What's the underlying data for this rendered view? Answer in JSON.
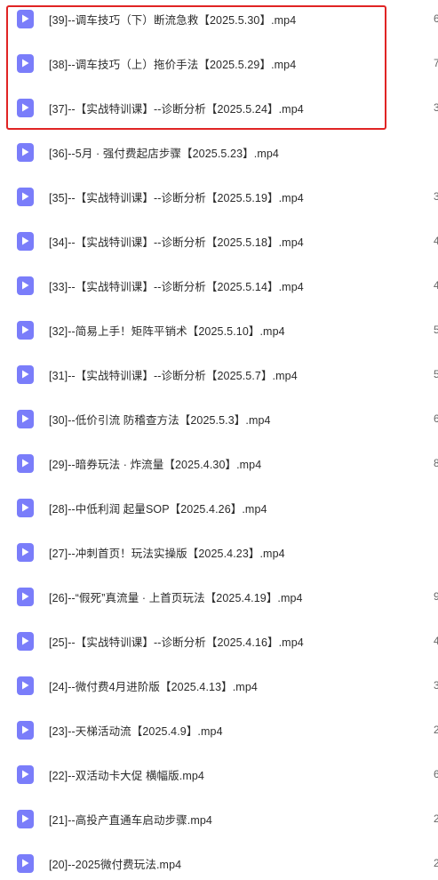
{
  "files": [
    {
      "name": "[39]--调车技巧（下）断流急救【2025.5.30】.mp4",
      "peek": "6"
    },
    {
      "name": "[38]--调车技巧（上）拖价手法【2025.5.29】.mp4",
      "peek": "7"
    },
    {
      "name": "[37]--【实战特训课】--诊断分析【2025.5.24】.mp4",
      "peek": "3"
    },
    {
      "name": "[36]--5月 · 强付费起店步骤【2025.5.23】.mp4",
      "peek": ""
    },
    {
      "name": "[35]--【实战特训课】--诊断分析【2025.5.19】.mp4",
      "peek": "3"
    },
    {
      "name": "[34]--【实战特训课】--诊断分析【2025.5.18】.mp4",
      "peek": "4"
    },
    {
      "name": "[33]--【实战特训课】--诊断分析【2025.5.14】.mp4",
      "peek": "4"
    },
    {
      "name": "[32]--简易上手！矩阵平销术【2025.5.10】.mp4",
      "peek": "5"
    },
    {
      "name": "[31]--【实战特训课】--诊断分析【2025.5.7】.mp4",
      "peek": "5"
    },
    {
      "name": "[30]--低价引流 防稽查方法【2025.5.3】.mp4",
      "peek": "6"
    },
    {
      "name": "[29]--暗券玩法 · 炸流量【2025.4.30】.mp4",
      "peek": "8"
    },
    {
      "name": "[28]--中低利润 起量SOP【2025.4.26】.mp4",
      "peek": ""
    },
    {
      "name": "[27]--冲刺首页！玩法实操版【2025.4.23】.mp4",
      "peek": ""
    },
    {
      "name": "[26]--“假死”真流量 · 上首页玩法【2025.4.19】.mp4",
      "peek": "9"
    },
    {
      "name": "[25]--【实战特训课】--诊断分析【2025.4.16】.mp4",
      "peek": "4"
    },
    {
      "name": "[24]--微付费4月进阶版【2025.4.13】.mp4",
      "peek": "3"
    },
    {
      "name": "[23]--天梯活动流【2025.4.9】.mp4",
      "peek": "2"
    },
    {
      "name": "[22]--双活动卡大促 横幅版.mp4",
      "peek": "6"
    },
    {
      "name": "[21]--高投产直通车启动步骤.mp4",
      "peek": "2"
    },
    {
      "name": "[20]--2025微付费玩法.mp4",
      "peek": "2"
    }
  ],
  "icon": {
    "name": "video-file-icon",
    "color": "#7a7dfa"
  },
  "highlight_color": "#e02424"
}
